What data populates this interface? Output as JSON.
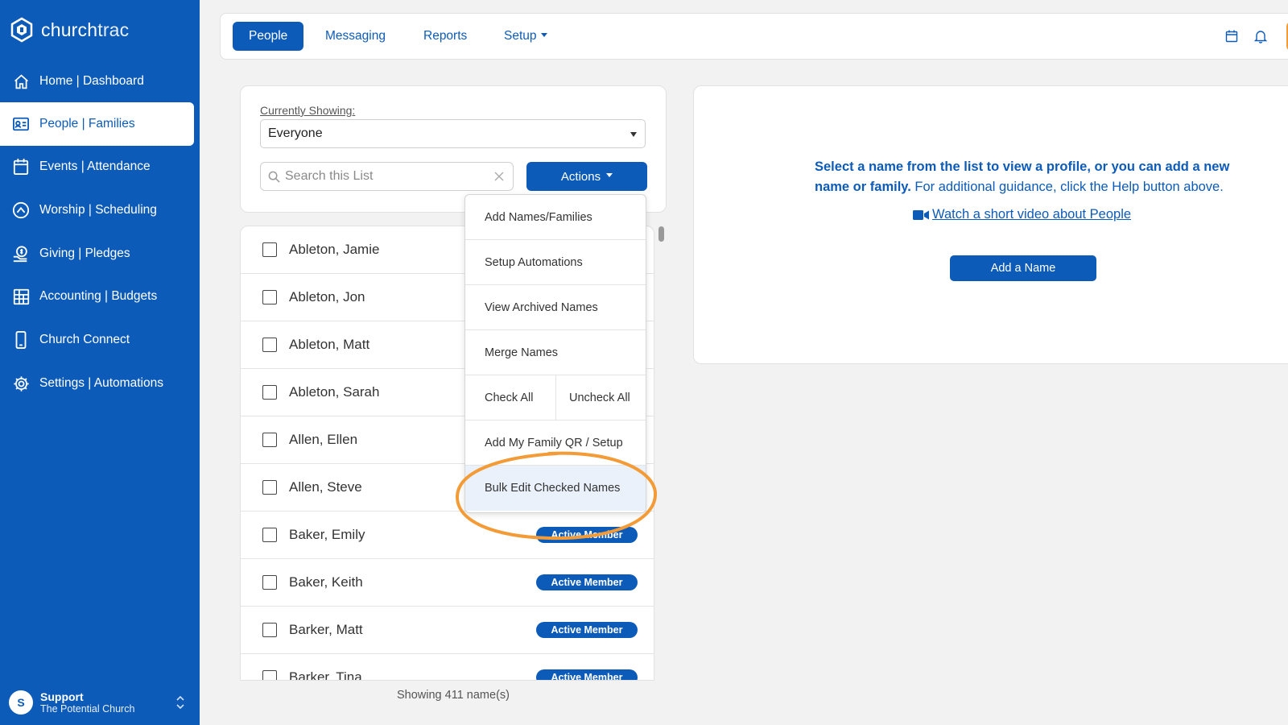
{
  "sidebar": {
    "logo_text_bold": "church",
    "logo_text_light": "trac",
    "items": [
      {
        "label": "Home | Dashboard",
        "icon": "home-icon"
      },
      {
        "label": "People | Families",
        "icon": "contact-card-icon"
      },
      {
        "label": "Events | Attendance",
        "icon": "calendar-icon"
      },
      {
        "label": "Worship | Scheduling",
        "icon": "worship-icon"
      },
      {
        "label": "Giving | Pledges",
        "icon": "giving-icon"
      },
      {
        "label": "Accounting | Budgets",
        "icon": "grid-icon"
      },
      {
        "label": "Church Connect",
        "icon": "phone-icon"
      },
      {
        "label": "Settings | Automations",
        "icon": "gear-icon"
      }
    ],
    "active_item": "People | Families",
    "support": {
      "initial": "S",
      "name": "Support",
      "org": "The Potential Church"
    }
  },
  "topbar": {
    "tabs": [
      "People",
      "Messaging",
      "Reports",
      "Setup"
    ],
    "active_tab": "People"
  },
  "filter": {
    "currently_showing_label": "Currently Showing:",
    "selected": "Everyone",
    "search_placeholder": "Search this List",
    "actions_label": "Actions"
  },
  "list": {
    "rows": [
      {
        "name": "Ableton, Jamie",
        "badge": ""
      },
      {
        "name": "Ableton, Jon",
        "badge": ""
      },
      {
        "name": "Ableton, Matt",
        "badge": ""
      },
      {
        "name": "Ableton, Sarah",
        "badge": ""
      },
      {
        "name": "Allen, Ellen",
        "badge": ""
      },
      {
        "name": "Allen, Steve",
        "badge": ""
      },
      {
        "name": "Baker, Emily",
        "badge": "Active Member"
      },
      {
        "name": "Baker, Keith",
        "badge": "Active Member"
      },
      {
        "name": "Barker, Matt",
        "badge": "Active Member"
      },
      {
        "name": "Barker, Tina",
        "badge": "Active Member"
      }
    ],
    "showing_text": "Showing 411 name(s)"
  },
  "actions_menu": {
    "items": [
      "Add Names/Families",
      "Setup Automations",
      "View Archived Names",
      "Merge Names"
    ],
    "check_all": "Check All",
    "uncheck_all": "Uncheck All",
    "add_my_family": "Add My Family QR / Setup",
    "bulk_edit": "Bulk Edit Checked Names"
  },
  "info": {
    "bold_text": "Select a name from the list to view a profile, or you can add a new name or family.",
    "regular_text": " For additional guidance, click the Help button above.",
    "video_link": "Watch a short video about People",
    "add_button": "Add a Name"
  },
  "colors": {
    "brand": "#0d5bb8",
    "highlight": "#f39b36"
  }
}
